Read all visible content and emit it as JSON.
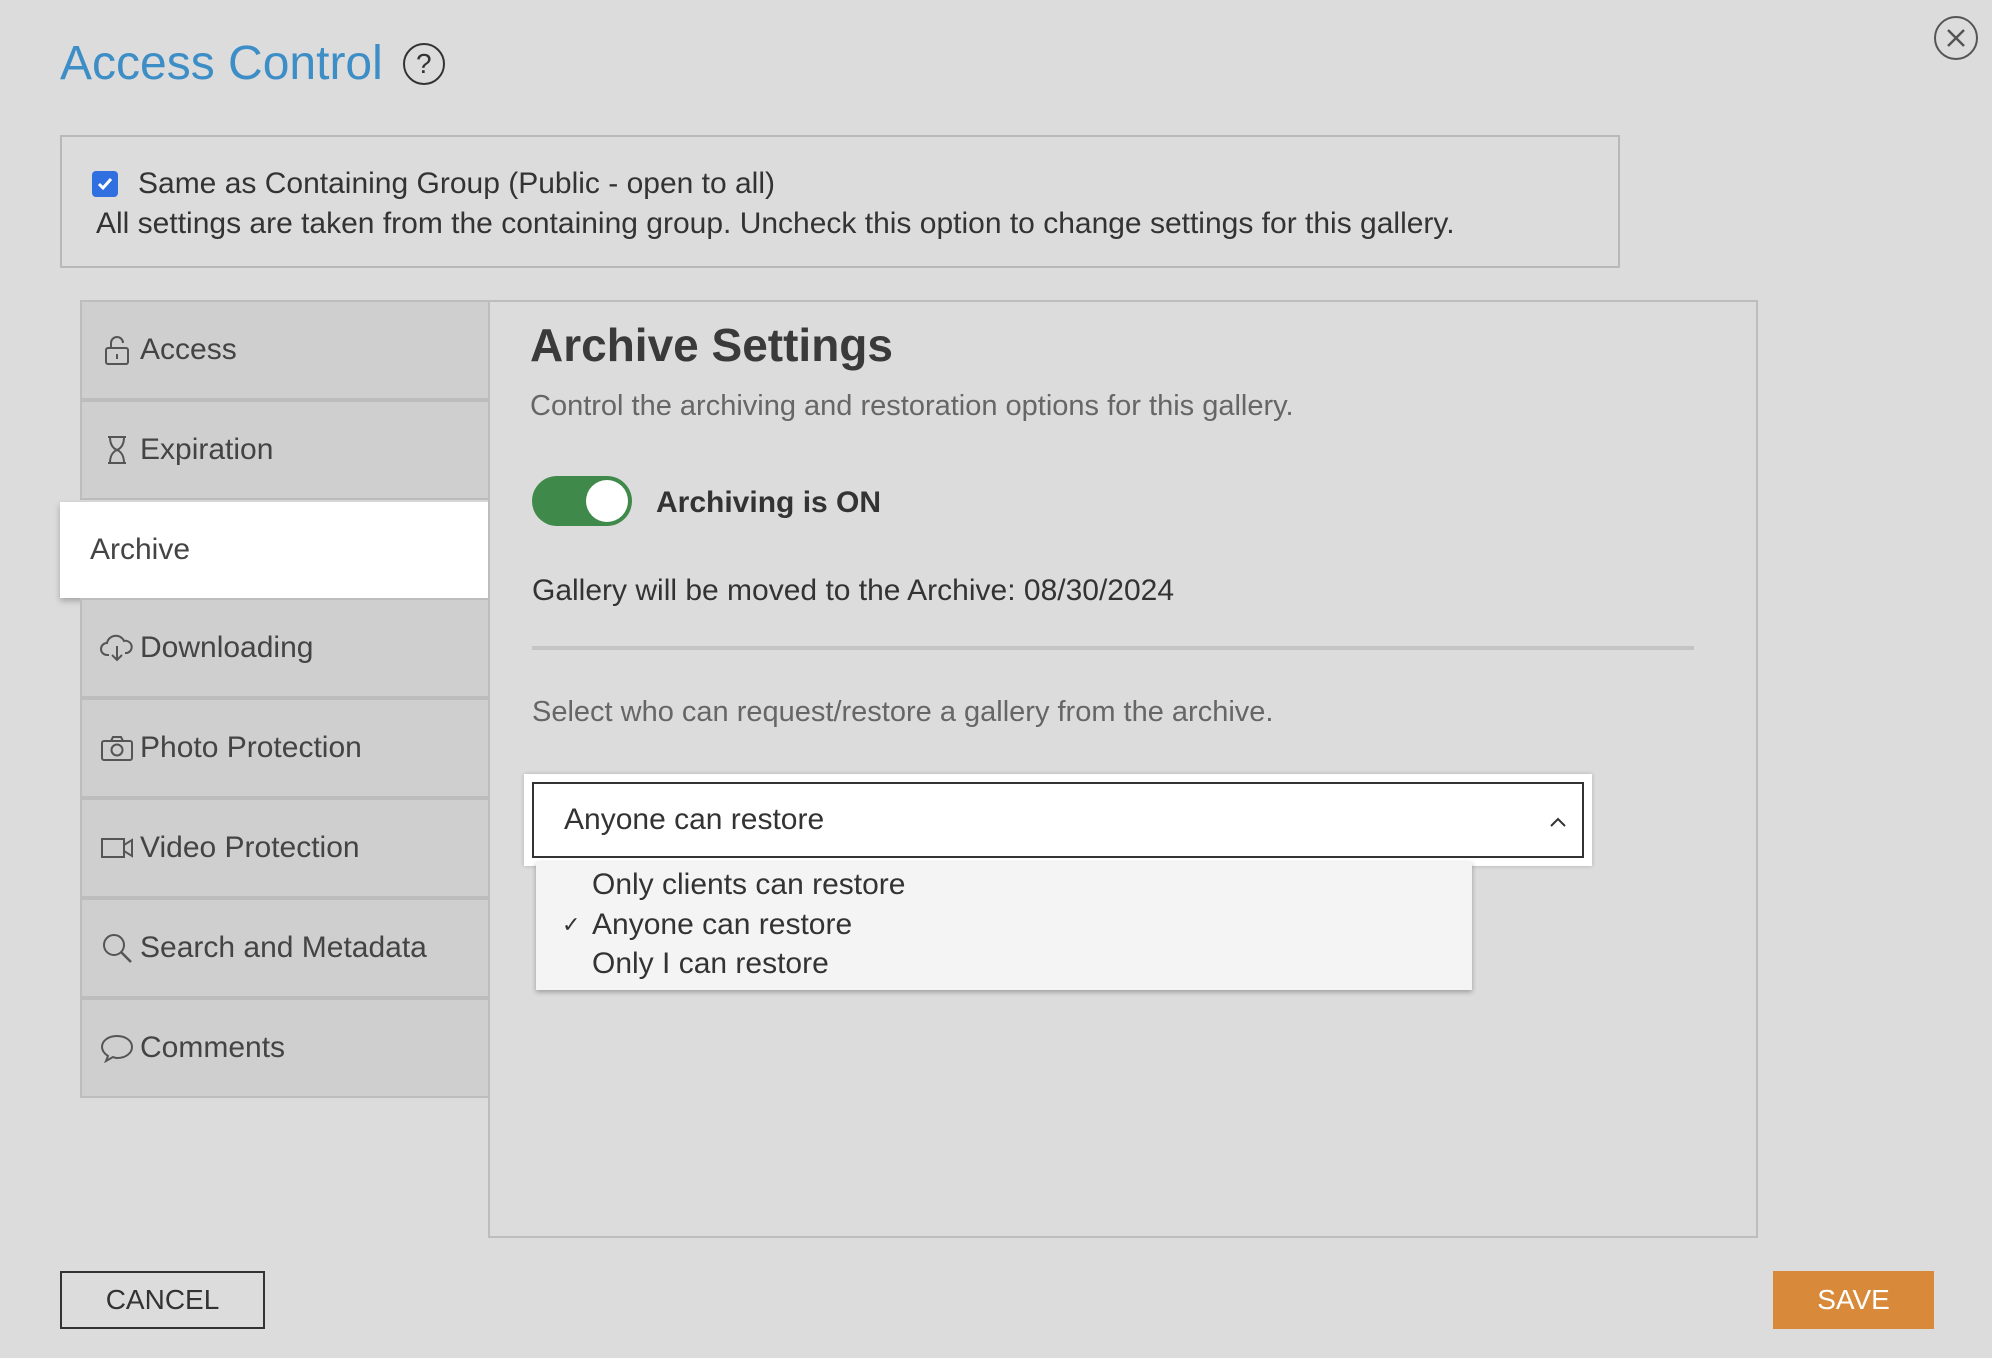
{
  "dialog": {
    "title": "Access Control",
    "help_glyph": "?",
    "close_icon": "close-icon"
  },
  "inherit": {
    "checked": true,
    "label": "Same as Containing Group (Public - open to all)",
    "description": "All settings are taken from the containing group. Uncheck this option to change settings for this gallery."
  },
  "sidebar": {
    "items": [
      {
        "label": "Access",
        "icon": "lock-icon"
      },
      {
        "label": "Expiration",
        "icon": "hourglass-icon"
      },
      {
        "label": "Archive",
        "icon": "",
        "active": true
      },
      {
        "label": "Downloading",
        "icon": "cloud-download-icon"
      },
      {
        "label": "Photo Protection",
        "icon": "camera-icon"
      },
      {
        "label": "Video Protection",
        "icon": "video-camera-icon"
      },
      {
        "label": "Search and Metadata",
        "icon": "search-icon"
      },
      {
        "label": "Comments",
        "icon": "comment-icon"
      }
    ]
  },
  "panel": {
    "title": "Archive Settings",
    "subtitle": "Control the archiving and restoration options for this gallery.",
    "toggle_on": true,
    "toggle_label": "Archiving is ON",
    "move_text": "Gallery will be moved to the Archive: 08/30/2024",
    "who_text": "Select who can request/restore a gallery from the archive.",
    "select": {
      "value": "Anyone can restore",
      "options": [
        {
          "label": "Only clients can restore",
          "selected": false
        },
        {
          "label": "Anyone can restore",
          "selected": true
        },
        {
          "label": "Only I can restore",
          "selected": false
        }
      ],
      "check_glyph": "✓"
    }
  },
  "footer": {
    "cancel_label": "CANCEL",
    "save_label": "SAVE",
    "save_color": "#d88a3a"
  }
}
